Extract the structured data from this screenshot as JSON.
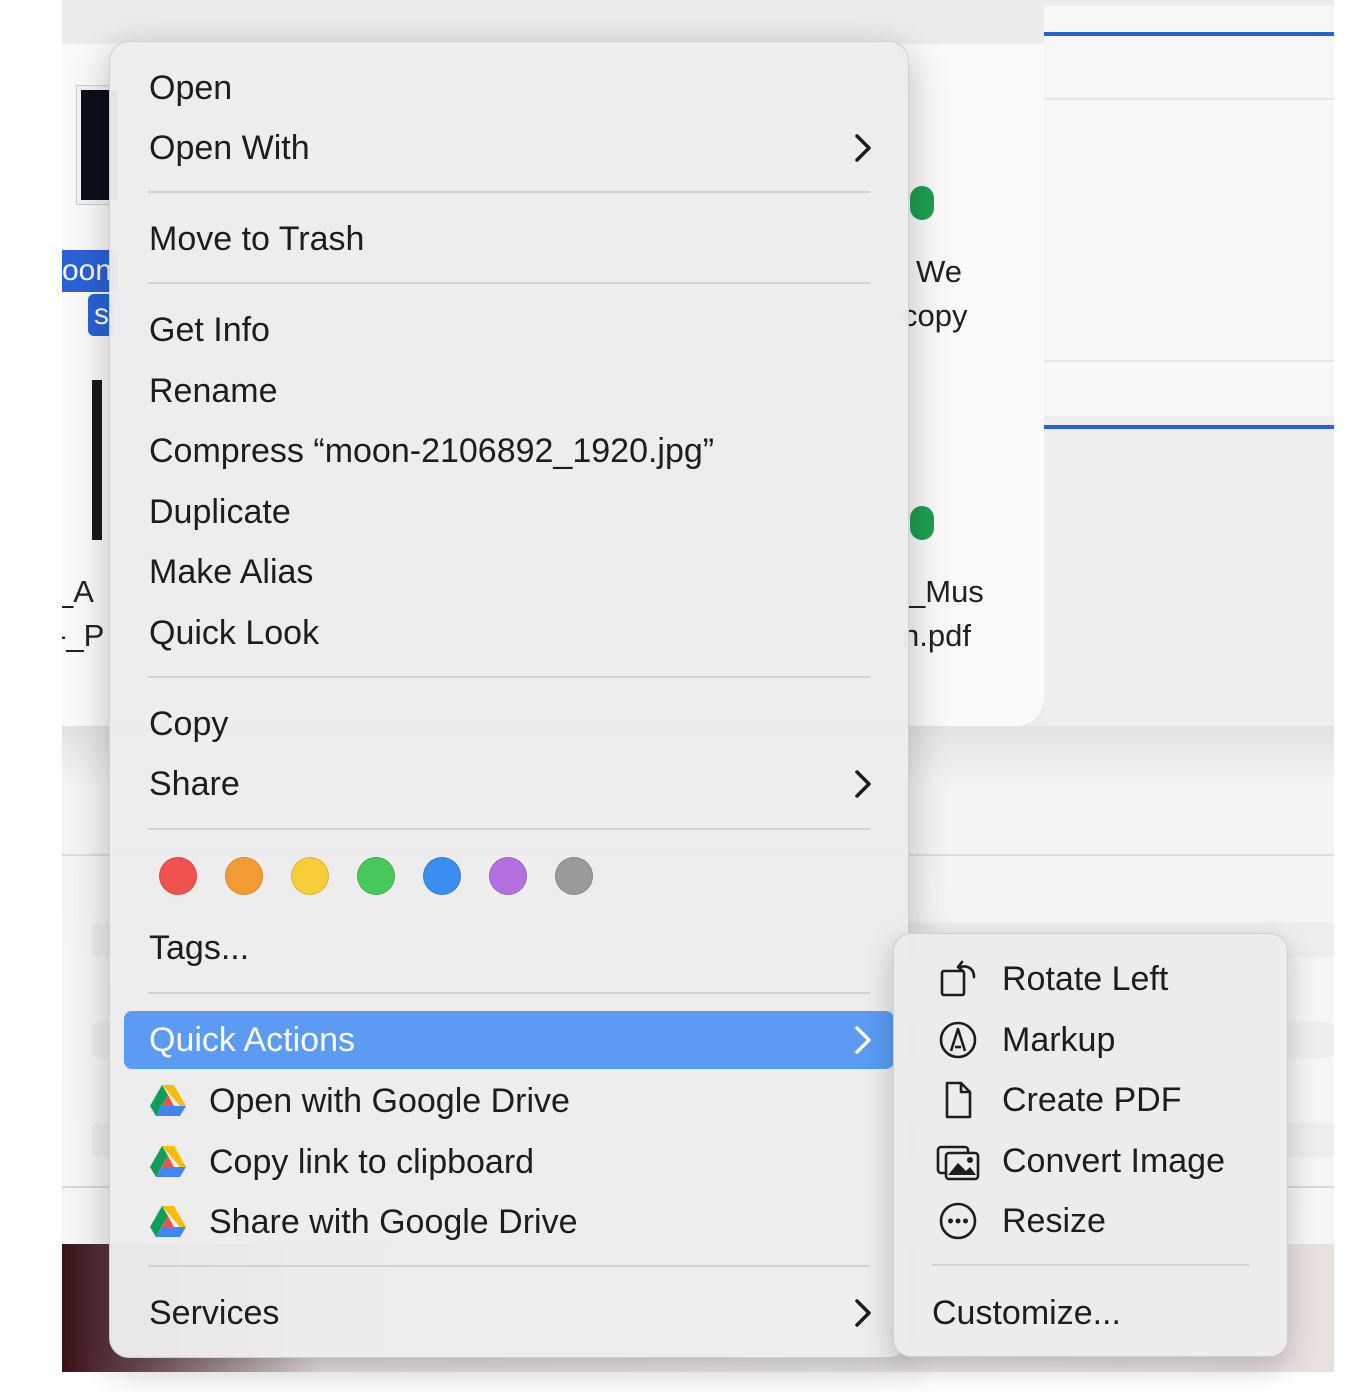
{
  "background": {
    "selected_label_fragments": [
      "oon",
      "s"
    ],
    "file_labels_left": [
      "_A",
      "-_P"
    ],
    "file_labels_right_top": [
      "We",
      "copy"
    ],
    "file_labels_right_bottom": [
      "_Mus",
      "n.pdf"
    ]
  },
  "menu": {
    "open": "Open",
    "open_with": "Open With",
    "move_to_trash": "Move to Trash",
    "get_info": "Get Info",
    "rename": "Rename",
    "compress": "Compress “moon-2106892_1920.jpg”",
    "duplicate": "Duplicate",
    "make_alias": "Make Alias",
    "quick_look": "Quick Look",
    "copy": "Copy",
    "share": "Share",
    "tags": "Tags...",
    "quick_actions": "Quick Actions",
    "open_google_drive": "Open with Google Drive",
    "copy_link": "Copy link to clipboard",
    "share_google_drive": "Share with Google Drive",
    "services": "Services",
    "chevron": "›"
  },
  "tag_colors": [
    "#f0524f",
    "#f49a33",
    "#f8cd3a",
    "#46c95a",
    "#3a8ef0",
    "#b46fde",
    "#9a9a9c"
  ],
  "accent": "#5b9bf3",
  "submenu": {
    "rotate_left": "Rotate Left",
    "markup": "Markup",
    "create_pdf": "Create PDF",
    "convert_image": "Convert Image",
    "resize": "Resize",
    "customize": "Customize..."
  }
}
